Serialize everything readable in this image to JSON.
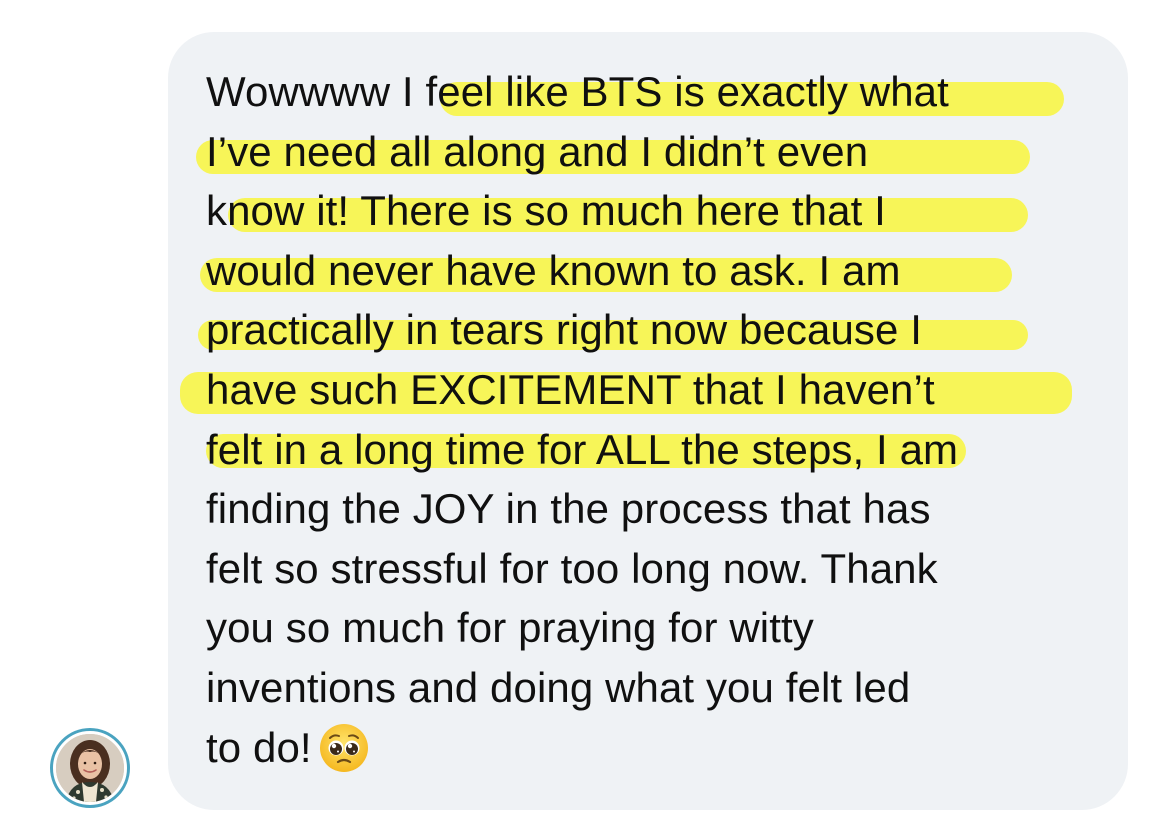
{
  "conversation": {
    "message_lines": [
      "Wowwww I feel like BTS is exactly what",
      "I’ve need all along and I didn’t even",
      "know it! There is so much here that I",
      "would never have known to ask. I am",
      "practically in tears right now because I",
      "have such EXCITEMENT that I haven’t",
      "felt in a long time for ALL the steps, I am",
      "finding the JOY in the process that has",
      "felt so stressful for too long now. Thank",
      "you so much for praying for witty",
      "inventions and doing what you felt led",
      "to do!"
    ],
    "emoji": "pleading-face-emoji",
    "avatar": "sender-avatar"
  },
  "colors": {
    "bubble": "#eff2f5",
    "highlight": "#f8f63c",
    "avatar_ring": "#4aa3c0",
    "text": "#101010"
  }
}
